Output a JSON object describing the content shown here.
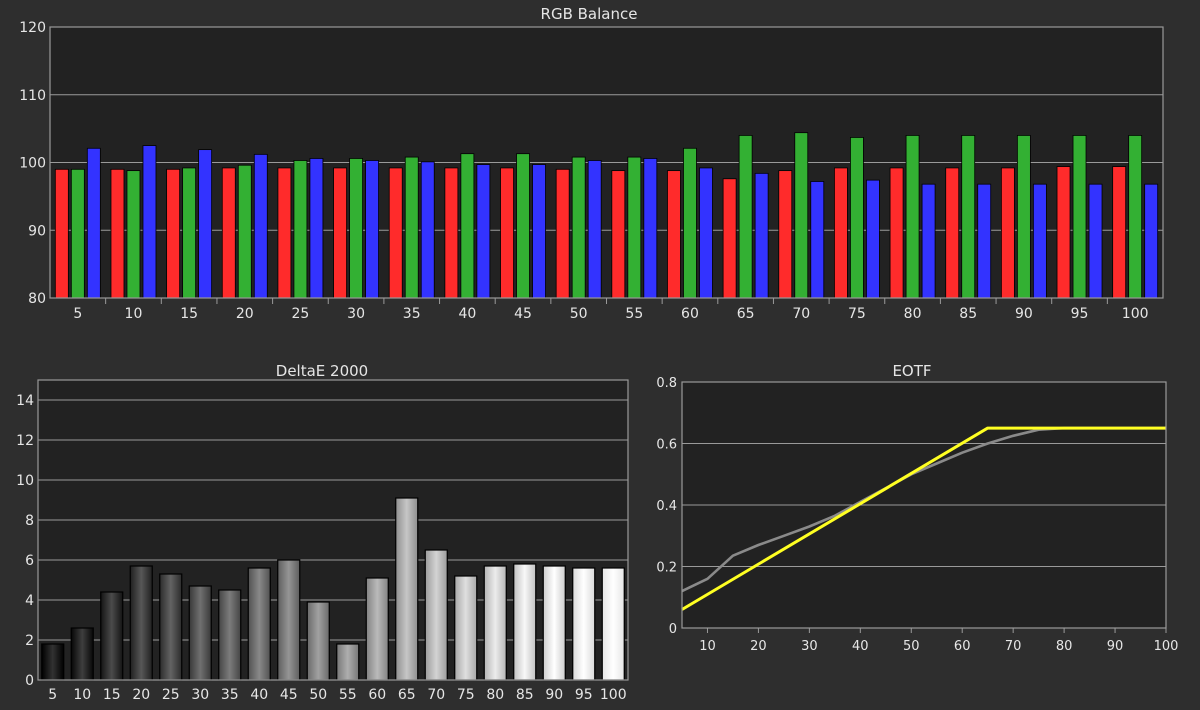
{
  "colors": {
    "background": "#2e2e2e",
    "plot_background": "#222222",
    "grid": "#9a9a9a",
    "text": "#e6e6e6",
    "red": "#ff2b2b",
    "green": "#33b033",
    "blue": "#3333ff",
    "eotf_measured": "#ffff22",
    "eotf_target": "#8a8a8a"
  },
  "chart_data": [
    {
      "type": "bar",
      "title": "RGB Balance",
      "xlabel": "",
      "ylabel": "",
      "ylim": [
        80,
        120
      ],
      "yticks": [
        "80",
        "90",
        "100",
        "110",
        "120"
      ],
      "grid": true,
      "categories": [
        "5",
        "10",
        "15",
        "20",
        "25",
        "30",
        "35",
        "40",
        "45",
        "50",
        "55",
        "60",
        "65",
        "70",
        "75",
        "80",
        "85",
        "90",
        "95",
        "100"
      ],
      "series": [
        {
          "color": "red",
          "values": [
            99.0,
            99.0,
            99.0,
            99.2,
            99.2,
            99.2,
            99.2,
            99.2,
            99.2,
            99.0,
            98.8,
            98.8,
            97.6,
            98.8,
            99.2,
            99.2,
            99.2,
            99.2,
            99.4,
            99.4
          ]
        },
        {
          "color": "green",
          "values": [
            99.0,
            98.8,
            99.2,
            99.6,
            100.3,
            100.6,
            100.8,
            101.3,
            101.3,
            100.8,
            100.8,
            102.1,
            104.0,
            104.4,
            103.7,
            104.0,
            104.0,
            104.0,
            104.0,
            104.0
          ]
        },
        {
          "color": "blue",
          "values": [
            102.1,
            102.5,
            101.9,
            101.2,
            100.6,
            100.3,
            100.1,
            99.7,
            99.7,
            100.3,
            100.6,
            99.2,
            98.4,
            97.2,
            97.4,
            96.8,
            96.8,
            96.8,
            96.8,
            96.8
          ]
        }
      ]
    },
    {
      "type": "bar",
      "title": "DeltaE 2000",
      "xlabel": "",
      "ylabel": "",
      "ylim": [
        0,
        15
      ],
      "yticks": [
        "0",
        "2",
        "4",
        "6",
        "8",
        "10",
        "12",
        "14"
      ],
      "grid": true,
      "categories": [
        "5",
        "10",
        "15",
        "20",
        "25",
        "30",
        "35",
        "40",
        "45",
        "50",
        "55",
        "60",
        "65",
        "70",
        "75",
        "80",
        "85",
        "90",
        "95",
        "100"
      ],
      "values": [
        1.8,
        2.6,
        4.4,
        5.7,
        5.3,
        4.7,
        4.5,
        5.6,
        6.0,
        3.9,
        1.8,
        5.1,
        9.1,
        6.5,
        5.2,
        5.7,
        5.8,
        5.7,
        5.6,
        5.6
      ]
    },
    {
      "type": "line",
      "title": "EOTF",
      "xlabel": "",
      "ylabel": "",
      "xlim": [
        5,
        100
      ],
      "ylim": [
        0,
        0.8
      ],
      "xticks": [
        "10",
        "20",
        "30",
        "40",
        "50",
        "60",
        "70",
        "80",
        "90",
        "100"
      ],
      "yticks": [
        "0",
        "0.2",
        "0.4",
        "0.6",
        "0.8"
      ],
      "grid": true,
      "series": [
        {
          "color": "eotf_target",
          "x": [
            5,
            10,
            15,
            20,
            25,
            30,
            35,
            40,
            45,
            50,
            55,
            60,
            65,
            70,
            75,
            80,
            85,
            90,
            95,
            100
          ],
          "y": [
            0.12,
            0.16,
            0.235,
            0.27,
            0.3,
            0.33,
            0.365,
            0.41,
            0.455,
            0.5,
            0.535,
            0.57,
            0.6,
            0.625,
            0.645,
            0.65,
            0.65,
            0.65,
            0.65,
            0.65
          ]
        },
        {
          "color": "eotf_measured",
          "x": [
            5,
            65,
            70,
            80,
            90,
            100
          ],
          "y": [
            0.06,
            0.65,
            0.65,
            0.65,
            0.65,
            0.65
          ]
        }
      ]
    }
  ]
}
